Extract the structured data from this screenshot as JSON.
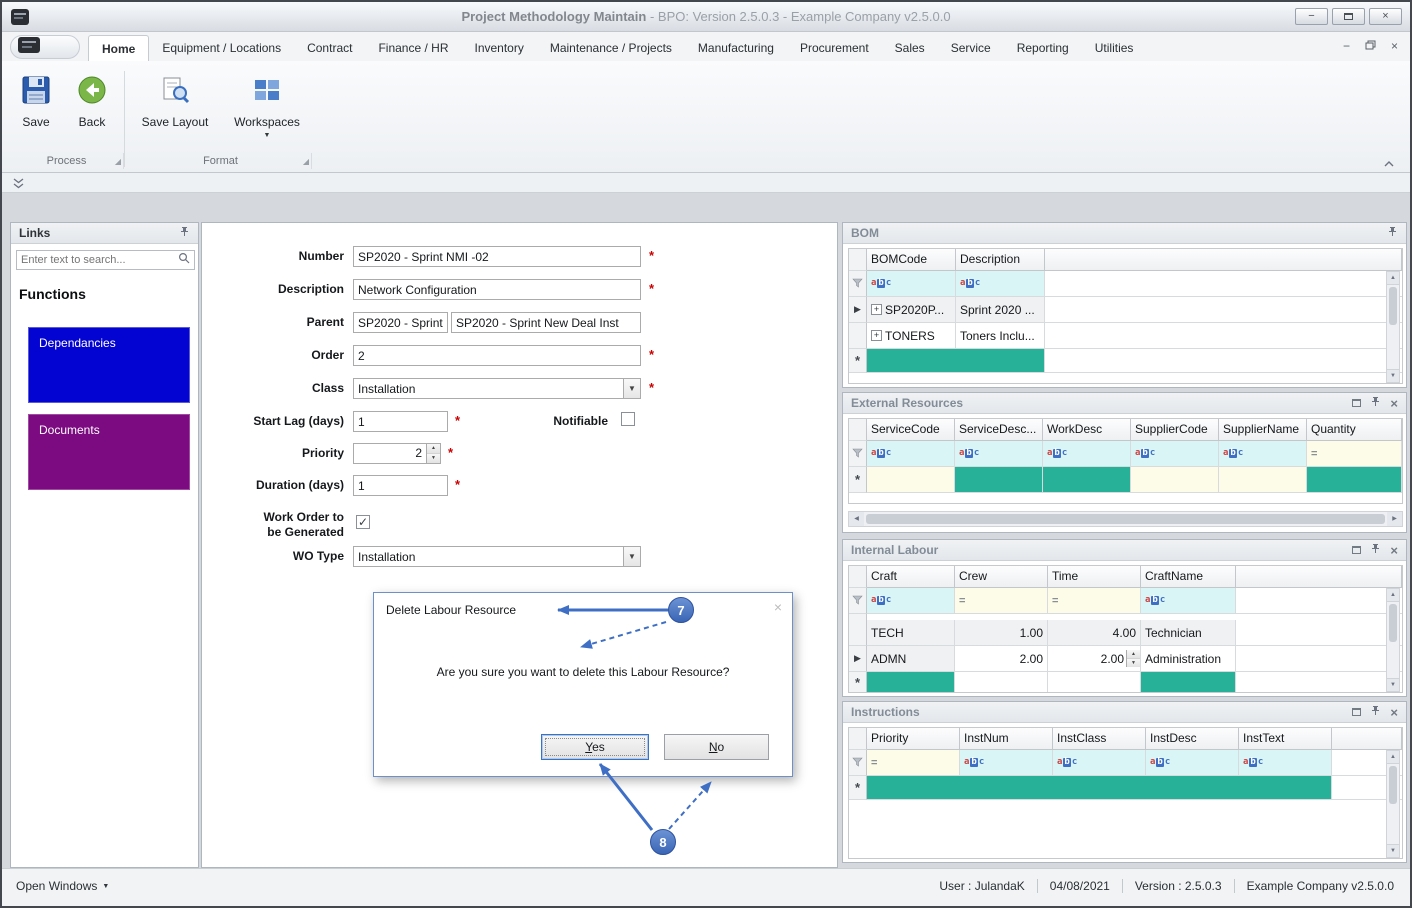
{
  "window": {
    "title_main": "Project Methodology Maintain",
    "title_rest": " - BPO: Version 2.5.0.3 - Example Company v2.5.0.0"
  },
  "menu": {
    "tabs": [
      "Home",
      "Equipment / Locations",
      "Contract",
      "Finance / HR",
      "Inventory",
      "Maintenance / Projects",
      "Manufacturing",
      "Procurement",
      "Sales",
      "Service",
      "Reporting",
      "Utilities"
    ]
  },
  "ribbon": {
    "save": "Save",
    "back": "Back",
    "save_layout": "Save Layout",
    "workspaces": "Workspaces",
    "groups": [
      "Process",
      "Format"
    ]
  },
  "links": {
    "title": "Links",
    "search_placeholder": "Enter text to search...",
    "section": "Functions",
    "items": [
      "Dependancies",
      "Documents"
    ]
  },
  "form": {
    "required": "*",
    "number": {
      "label": "Number",
      "value": "SP2020 - Sprint NMI -02"
    },
    "description": {
      "label": "Description",
      "value": "Network Configuration"
    },
    "parent": {
      "label": "Parent",
      "value1": "SP2020 - Sprint",
      "value2": "SP2020 - Sprint New Deal Inst"
    },
    "order": {
      "label": "Order",
      "value": "2"
    },
    "class": {
      "label": "Class",
      "value": "Installation"
    },
    "start_lag": {
      "label": "Start Lag (days)",
      "value": "1"
    },
    "notifiable": {
      "label": "Notifiable"
    },
    "priority": {
      "label": "Priority",
      "value": "2"
    },
    "duration": {
      "label": "Duration (days)",
      "value": "1"
    },
    "work_order": {
      "label_line1": "Work Order to",
      "label_line2": "be Generated"
    },
    "wo_type": {
      "label": "WO Type",
      "value": "Installation"
    }
  },
  "dialog": {
    "title": "Delete Labour Resource",
    "message": "Are you sure you want to delete this Labour Resource?",
    "yes": "Yes",
    "no": "No"
  },
  "annotations": {
    "step7": "7",
    "step8": "8"
  },
  "panels": {
    "bom": {
      "title": "BOM",
      "columns": [
        "BOMCode",
        "Description"
      ],
      "rows": [
        {
          "code": "SP2020P...",
          "desc": "Sprint 2020 ..."
        },
        {
          "code": "TONERS",
          "desc": "Toners Inclu..."
        }
      ]
    },
    "external": {
      "title": "External Resources",
      "columns": [
        "ServiceCode",
        "ServiceDesc...",
        "WorkDesc",
        "SupplierCode",
        "SupplierName",
        "Quantity"
      ]
    },
    "labour": {
      "title": "Internal Labour",
      "columns": [
        "Craft",
        "Crew",
        "Time",
        "CraftName"
      ],
      "rows": [
        {
          "craft": "TECH",
          "crew": "1.00",
          "time": "4.00",
          "name": "Technician"
        },
        {
          "craft": "ADMN",
          "crew": "2.00",
          "time": "2.00",
          "name": "Administration"
        }
      ]
    },
    "instructions": {
      "title": "Instructions",
      "columns": [
        "Priority",
        "InstNum",
        "InstClass",
        "InstDesc",
        "InstText"
      ]
    }
  },
  "status": {
    "open_windows": "Open Windows",
    "user": "User : JulandaK",
    "date": "04/08/2021",
    "version": "Version : 2.5.0.3",
    "company": "Example Company v2.5.0.0"
  },
  "colors": {
    "teal_new_cell": "#27b199",
    "filter_cyan": "#d9f5f6",
    "filter_yellow": "#fdfce8",
    "annotation_blue": "#3f6fc4",
    "dependancies_blue": "#0404d2",
    "documents_purple": "#7c0a80",
    "required_red": "#cc0000"
  }
}
